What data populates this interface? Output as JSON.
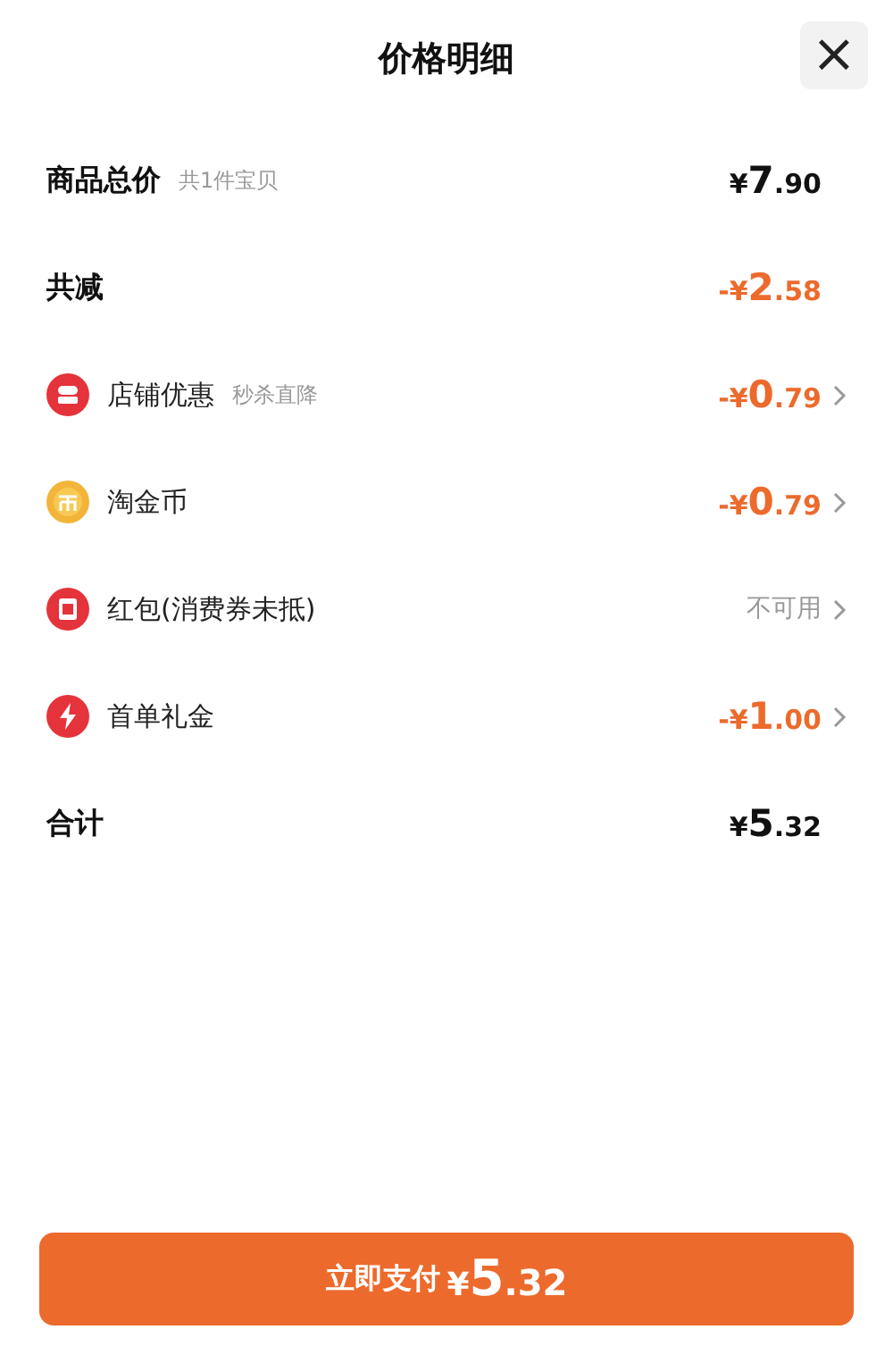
{
  "header": {
    "title": "价格明细",
    "close": "×"
  },
  "rows": [
    {
      "kind": "summary",
      "label": "商品总价",
      "note": "共1件宝贝",
      "value": "¥7.90",
      "color": "#111111",
      "chevron": false
    },
    {
      "kind": "summary",
      "label": "共减",
      "value": "-¥2.58",
      "color": "#ec6a2c",
      "chevron": false
    },
    {
      "kind": "shop",
      "label": "店铺优惠",
      "note": "秒杀直降",
      "value": "-¥0.79",
      "color": "#ec6a2c",
      "chevron": true
    },
    {
      "kind": "coin",
      "label": "淘金币",
      "value": "-¥0.79",
      "color": "#ec6a2c",
      "chevron": true
    },
    {
      "kind": "packet",
      "label": "红包(消费券未抵)",
      "value": "不可用",
      "color": "#999999",
      "chevron": true
    },
    {
      "kind": "bolt",
      "label": "首单礼金",
      "value": "-¥1.00",
      "color": "#ec6a2c",
      "chevron": true
    },
    {
      "kind": "summary",
      "label": "合计",
      "value": "¥5.32",
      "color": "#111111",
      "chevron": false
    }
  ],
  "pay_button": {
    "label": "立即支付",
    "value": "¥5.32"
  }
}
